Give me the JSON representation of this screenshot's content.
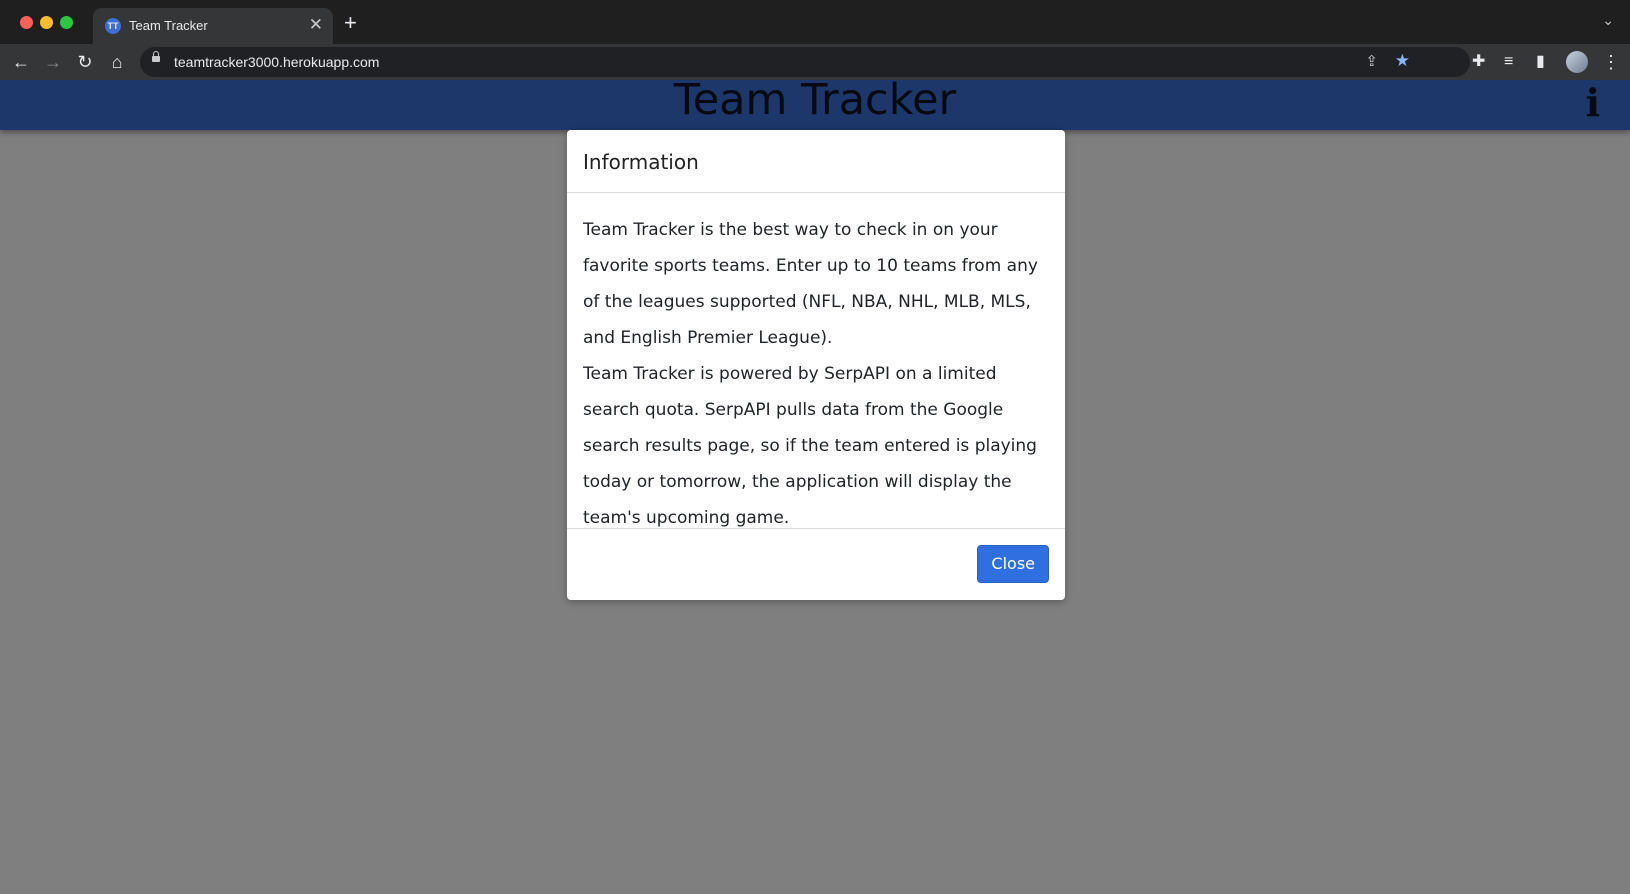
{
  "browser": {
    "tab_title": "Team Tracker",
    "tab_favicon_text": "TT",
    "url": "teamtracker3000.herokuapp.com"
  },
  "page": {
    "header_title": "Team Tracker",
    "info_icon": "i"
  },
  "modal": {
    "title": "Information",
    "paragraph_1": "Team Tracker is the best way to check in on your favorite sports teams. Enter up to 10 teams from any of the leagues supported (NFL, NBA, NHL, MLB, MLS, and English Premier League).",
    "paragraph_2": "Team Tracker is powered by SerpAPI on a limited search quota. SerpAPI pulls data from the Google search results page, so if the team entered is playing today or tomorrow, the application will display the team's upcoming game.",
    "close_label": "Close"
  },
  "colors": {
    "header_blue": "#3b6fd6",
    "button_blue": "#2f6fe0",
    "backdrop": "rgba(0,0,0,0.5)"
  }
}
